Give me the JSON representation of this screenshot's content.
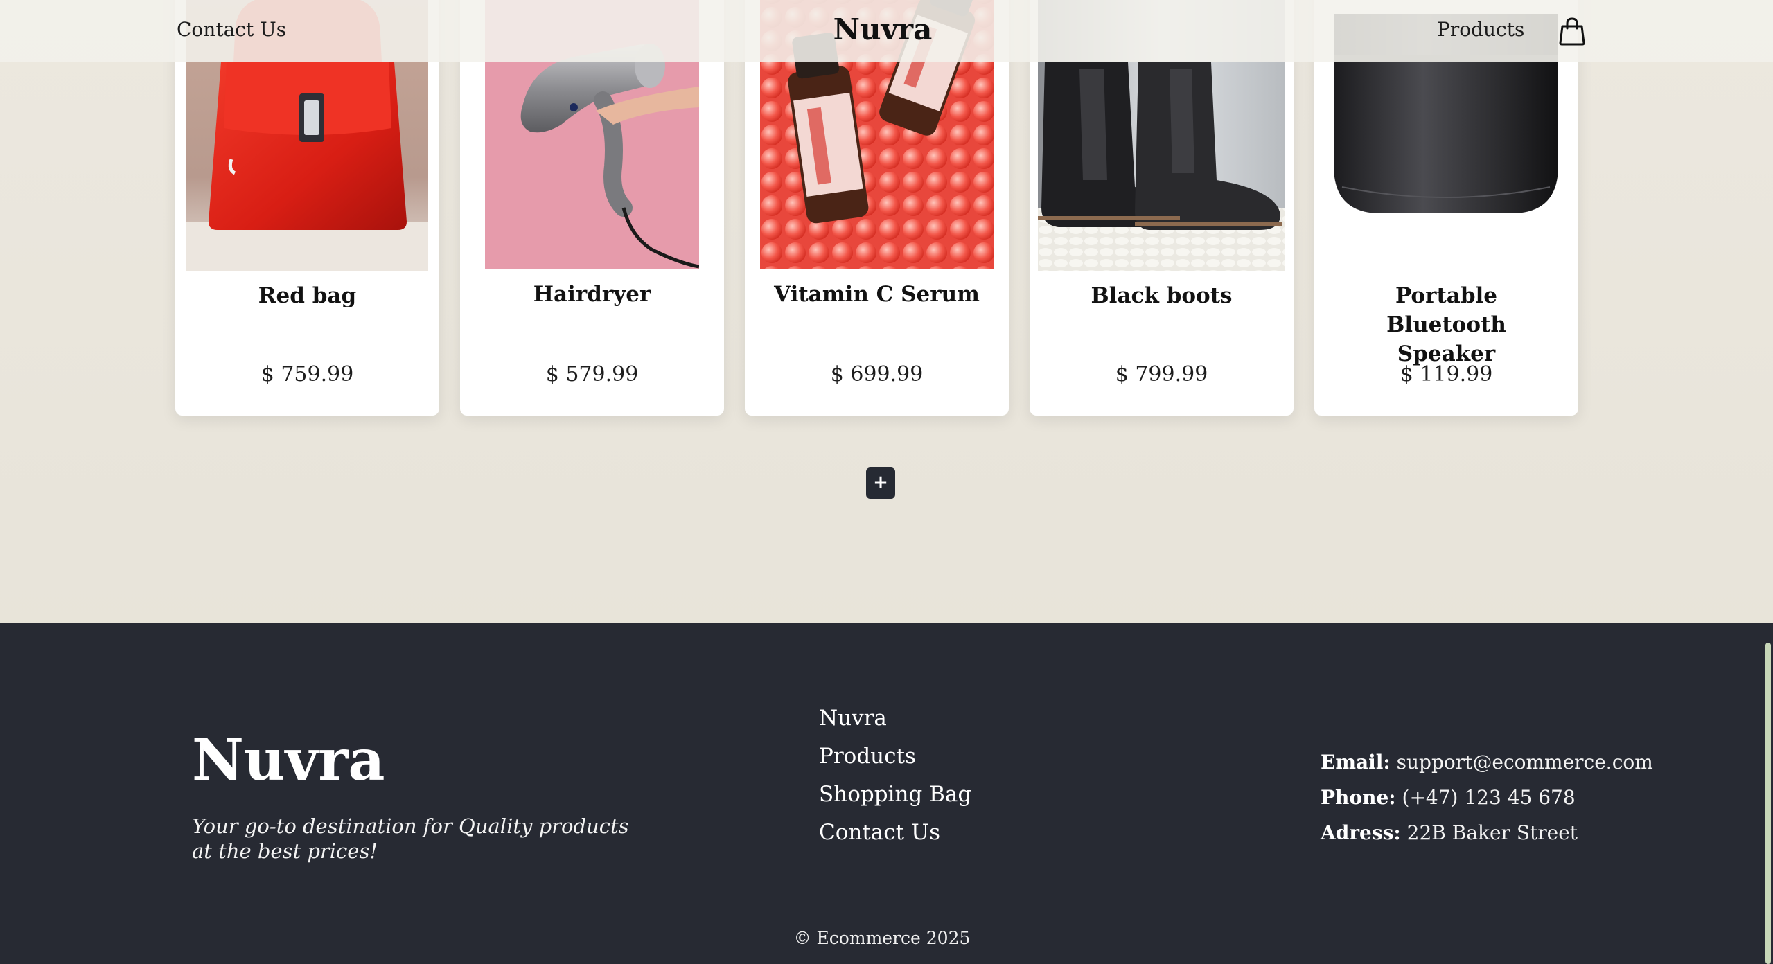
{
  "header": {
    "contact_label": "Contact Us",
    "logo": "Nuvra",
    "products_label": "Products",
    "bag_icon": "shopping-bag-icon"
  },
  "products": [
    {
      "name": "Red bag",
      "price": "$ 759.99"
    },
    {
      "name": "Hairdryer",
      "price": "$ 579.99"
    },
    {
      "name": "Vitamin C Serum",
      "price": "$ 699.99"
    },
    {
      "name": "Black boots",
      "price": "$ 799.99"
    },
    {
      "name": "Portable Bluetooth Speaker",
      "price": "$ 119.99"
    }
  ],
  "load_more": {
    "label": "+"
  },
  "footer": {
    "logo": "Nuvra",
    "tagline": "Your go-to destination for Quality products at the best prices!",
    "links": [
      "Nuvra",
      "Products",
      "Shopping Bag",
      "Contact Us"
    ],
    "contact": {
      "email_label": "Email:",
      "email": "support@ecommerce.com",
      "phone_label": "Phone:",
      "phone": "(+47) 123 45 678",
      "address_label": "Adress:",
      "address": "22B Baker Street"
    },
    "copyright": "© Ecommerce 2025"
  },
  "colors": {
    "page_bg": "#e6e2d8",
    "footer_bg": "#272a33",
    "button_bg": "#262a33",
    "card_bg": "#ffffff"
  }
}
